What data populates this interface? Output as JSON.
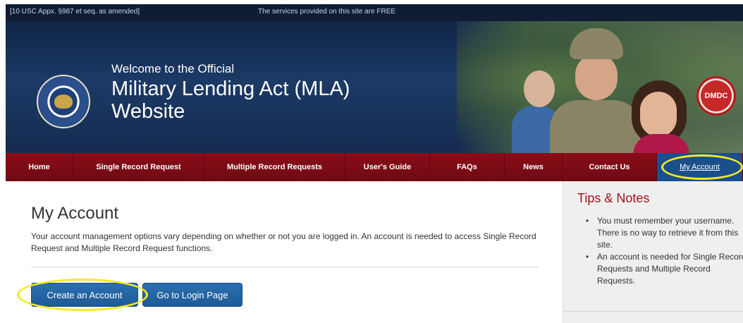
{
  "topbar": {
    "legal": "[10 USC Appx. §987 et seq. as amended]",
    "free_notice": "The services provided on this site are FREE"
  },
  "banner": {
    "welcome_small": "Welcome to the Official",
    "welcome_big": "Military Lending Act (MLA) Website",
    "badge": "DMDC"
  },
  "nav": {
    "items": [
      {
        "label": "Home"
      },
      {
        "label": "Single Record Request"
      },
      {
        "label": "Multiple Record Requests"
      },
      {
        "label": "User's Guide"
      },
      {
        "label": "FAQs"
      },
      {
        "label": "News"
      },
      {
        "label": "Contact Us"
      },
      {
        "label": "My Account",
        "active": true
      }
    ],
    "active_color": "#1b4f8c",
    "bar_color": "#7c0b15"
  },
  "main": {
    "title": "My Account",
    "intro": "Your account management options vary depending on whether or not you are logged in. An account is needed to access Single Record Request and Multiple Record Request functions.",
    "create_button": "Create an Account",
    "login_button": "Go to Login Page"
  },
  "sidebar": {
    "title": "Tips & Notes",
    "tips": [
      "You must remember your username. There is no way to retrieve it from this site.",
      "An account is needed for Single Record Requests and Multiple Record Requests."
    ]
  },
  "annotation": {
    "highlight_color": "#f3ea22"
  }
}
